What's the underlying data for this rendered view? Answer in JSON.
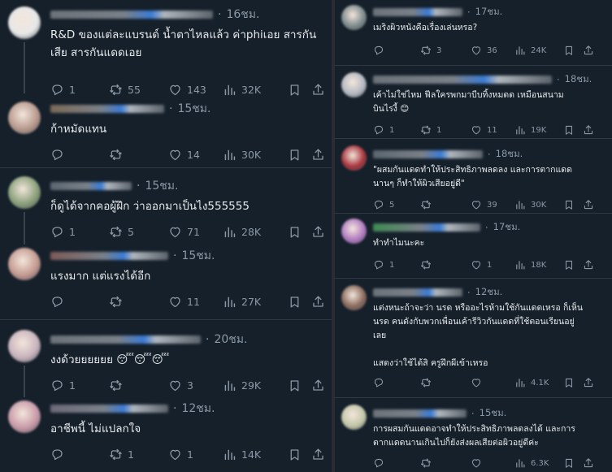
{
  "left_column": [
    {
      "time": "16ชม.",
      "text": "R&D ของแต่ละแบรนด์ น้ำตาไหลแล้ว ค่าphiเอย สารกัน\nเสีย สารกันแดดเอย",
      "replies": "1",
      "retweets": "55",
      "likes": "143",
      "views": "32K",
      "avatar_color": "#e8e8e8",
      "name_color": "#6d737a"
    },
    {
      "time": "15ชม.",
      "text": "ก้าหมัดแทน",
      "replies": "",
      "retweets": "",
      "likes": "14",
      "views": "30K",
      "avatar_color": "#b99a8e",
      "name_color": "#7d6a58"
    },
    {
      "time": "15ชม.",
      "text": "ก็ดูได้จากคอผู้ฝึก ว่าออกมาเป็นไง555555",
      "replies": "1",
      "retweets": "5",
      "likes": "71",
      "views": "28K",
      "avatar_color": "#8aa07a",
      "name_color": "#5c6670"
    },
    {
      "time": "15ชม.",
      "text": "แรงมาก แต่แรงได้อีก",
      "replies": "",
      "retweets": "",
      "likes": "11",
      "views": "27K",
      "avatar_color": "#c49a90",
      "name_color": "#7d5a58"
    },
    {
      "time": "20ชม.",
      "text": "งงด้วยยยยยย 😴😴😴",
      "replies": "1",
      "retweets": "",
      "likes": "3",
      "views": "29K",
      "avatar_color": "#c9b4bd",
      "name_color": "#6d737a"
    },
    {
      "time": "12ชม.",
      "text": "อาชีพนี้ ไม่แปลกใจ",
      "replies": "",
      "retweets": "1",
      "likes": "1",
      "views": "14K",
      "avatar_color": "#c89aa8",
      "name_color": "#6d6a7a"
    }
  ],
  "right_column": [
    {
      "time": "17ชม.",
      "text": "เมริงผิวหนังคือเรื่องเล่นหรอ?",
      "replies": "",
      "retweets": "3",
      "likes": "36",
      "views": "24K",
      "avatar_color": "#7e8a8c",
      "name_color": "#6d737a"
    },
    {
      "time": "18ชม.",
      "text": "เค้าไม่ใช่ไหม ฟีลใครพกมาบีบทิ้งหมดด    เหมือนสนาม\nบินไรงี้ 😊",
      "replies": "1",
      "retweets": "1",
      "likes": "11",
      "views": "19K",
      "avatar_color": "#b5b9c2",
      "name_color": "#6d737a"
    },
    {
      "time": "18ชม.",
      "text": "\"ผสมกันแดดทำให้ประสิทธิภาพลดลง และการตากแดด\nนานๆ ก็ทำให้ผิวเสียอยู่ดี\"",
      "replies": "5",
      "retweets": "",
      "likes": "39",
      "views": "30K",
      "avatar_color": "#a8343c",
      "name_color": "#5c6670"
    },
    {
      "time": "17ชม.",
      "text": "ทำทำไมนะคะ",
      "replies": "1",
      "retweets": "",
      "likes": "1",
      "views": "18K",
      "avatar_color": "#b07ac0",
      "name_color": "#3f8a52"
    },
    {
      "time": "12ชม.",
      "text": "แต่งหนะถ้าจะว่า นรด หรืออะไรห้ามใช้กันแดดเหรอ ก็เห็น\nนรด คนดังกับพวกเพื่อนเค้ารีวิวกันแดดที่ใช้ตอนเรียนอยู่\nเลย\n\nแสดงว่าใช้ได้สิ ครูฝึกผีเข้าเหรอ",
      "replies": "",
      "retweets": "",
      "likes": "",
      "views": "4.1K",
      "avatar_color": "#8a6a5c",
      "name_color": "#6d737a"
    },
    {
      "time": "15ชม.",
      "text": "การผสมกันแดดอาจทำให้ประสิทธิภาพลดลงได้ และการ\nตากแดดนานเกินไปก็ยังส่งผลเสียต่อผิวอยู่ดีค่ะ",
      "replies": "",
      "retweets": "",
      "likes": "",
      "views": "6.3K",
      "avatar_color": "#c2c7a8",
      "name_color": "#6d737a"
    }
  ],
  "icons": {
    "reply": "reply-icon",
    "retweet": "retweet-icon",
    "like": "heart-icon",
    "views": "views-chart-icon",
    "bookmark": "bookmark-icon",
    "share": "share-icon"
  },
  "colors": {
    "background": "#15202b",
    "muted_text": "#8b98a5",
    "text": "#e7e9ea",
    "divider": "#2f3943",
    "gutter": "#2a2d31"
  }
}
